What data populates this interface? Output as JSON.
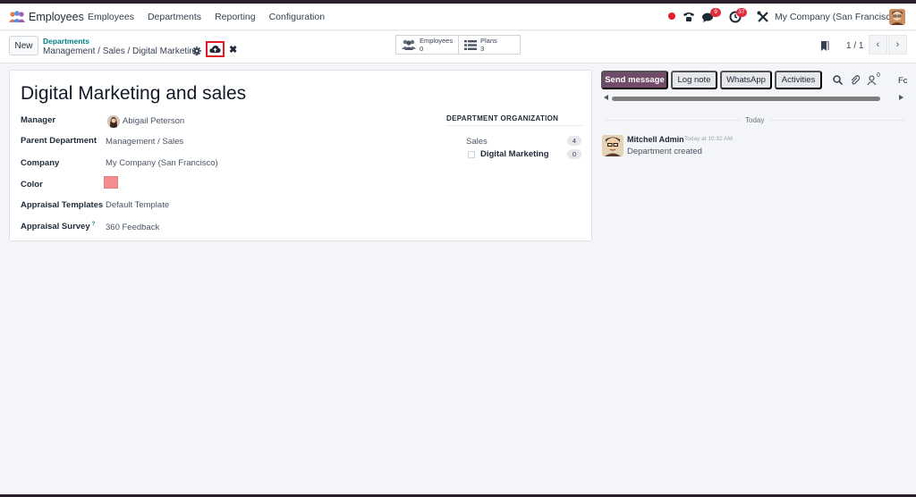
{
  "navbar": {
    "app_name": "Employees",
    "menu": [
      "Employees",
      "Departments",
      "Reporting",
      "Configuration"
    ],
    "messages_badge": "9",
    "activities_badge": "37",
    "company": "My Company (San Francisco)"
  },
  "control_panel": {
    "new_label": "New",
    "breadcrumb_parent": "Departments",
    "breadcrumb_current": "Management / Sales / Digital Marketing",
    "smart_buttons": [
      {
        "label": "Employees",
        "value": "0"
      },
      {
        "label": "Plans",
        "value": "3"
      }
    ],
    "pager": "1 / 1"
  },
  "form": {
    "title": "Digital Marketing and sales",
    "fields": [
      {
        "label": "Manager",
        "value": "Abigail Peterson"
      },
      {
        "label": "Parent Department",
        "value": "Management / Sales"
      },
      {
        "label": "Company",
        "value": "My Company (San Francisco)"
      },
      {
        "label": "Color",
        "value": ""
      },
      {
        "label": "Appraisal Templates",
        "value": "Default Template"
      },
      {
        "label": "Appraisal Survey",
        "value": "360 Feedback",
        "help": "?"
      }
    ],
    "color_hex": "#f28e8e",
    "org": {
      "heading": "DEPARTMENT ORGANIZATION",
      "items": [
        {
          "name": "Sales",
          "count": "4"
        },
        {
          "name": "Digital Marketing",
          "count": "0"
        }
      ]
    }
  },
  "chatter": {
    "buttons": [
      "Send message",
      "Log note",
      "WhatsApp",
      "Activities"
    ],
    "follower_count": "0",
    "truncated_label": "Fc",
    "date_separator": "Today",
    "message": {
      "author": "Mitchell Admin",
      "time": "Today at 10:32 AM",
      "body": "Department created"
    }
  },
  "colors": {
    "primary": "#714b67",
    "link": "#017e84",
    "badge": "#e02e3d",
    "highlight": "#e01b24"
  }
}
